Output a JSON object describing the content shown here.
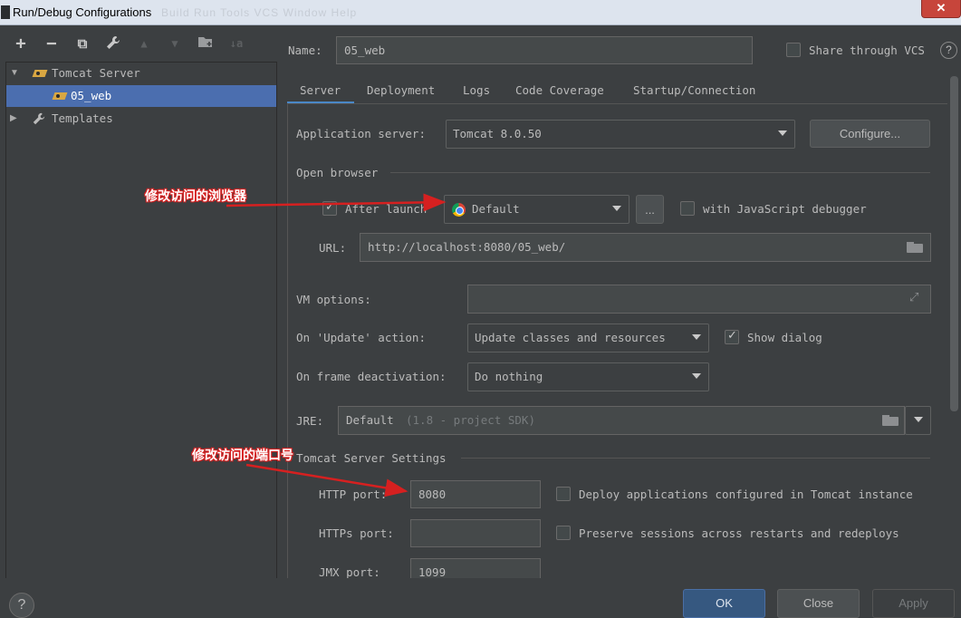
{
  "window": {
    "title": "Run/Debug Configurations",
    "ghost_menu": "Build  Run  Tools  VCS  Window  Help",
    "close_glyph": "✕"
  },
  "toolbar": {
    "add": "+",
    "remove": "−",
    "copy": "⧉",
    "edit": "🔧",
    "up": "▲",
    "down": "▼",
    "folder": "📁",
    "sort": "↓a"
  },
  "tree": {
    "tomcat_server": "Tomcat Server",
    "config_item": "05_web",
    "templates": "Templates"
  },
  "name": {
    "label": "Name:",
    "value": "05_web"
  },
  "share_vcs": {
    "label": "Share through VCS",
    "checked": false,
    "help": "?"
  },
  "tabs": [
    "Server",
    "Deployment",
    "Logs",
    "Code Coverage",
    "Startup/Connection"
  ],
  "active_tab": "Server",
  "server": {
    "app_server_label": "Application server:",
    "app_server_value": "Tomcat 8.0.50",
    "configure_button": "Configure...",
    "open_browser_label": "Open browser",
    "after_launch_label": "After launch",
    "after_launch_checked": true,
    "browser_value": "Default",
    "browse_button": "...",
    "js_debugger_label": "with JavaScript debugger",
    "js_debugger_checked": false,
    "url_label": "URL:",
    "url_value": "http://localhost:8080/05_web/",
    "vm_options_label": "VM options:",
    "vm_options_value": "",
    "on_update_label": "On 'Update' action:",
    "on_update_value": "Update classes and resources",
    "show_dialog_label": "Show dialog",
    "show_dialog_checked": true,
    "on_frame_label": "On frame deactivation:",
    "on_frame_value": "Do nothing",
    "jre_label": "JRE:",
    "jre_value": "Default",
    "jre_hint": "(1.8 - project SDK)",
    "tomcat_settings_label": "Tomcat Server Settings",
    "http_port_label": "HTTP port:",
    "http_port_value": "8080",
    "deploy_label": "Deploy applications configured in Tomcat instance",
    "deploy_checked": false,
    "https_port_label": "HTTPs port:",
    "https_port_value": "",
    "preserve_label": "Preserve sessions across restarts and redeploys",
    "preserve_checked": false,
    "jmx_port_label": "JMX port:",
    "jmx_port_value": "1099"
  },
  "annotations": {
    "browser_note": "修改访问的浏览器",
    "port_note": "修改访问的端口号"
  },
  "buttons": {
    "ok": "OK",
    "close": "Close",
    "apply": "Apply",
    "help": "?"
  },
  "colors": {
    "background": "#3c3f41",
    "selection": "#4b6eaf",
    "ok_button": "#365880",
    "annotation": "#d62020"
  }
}
